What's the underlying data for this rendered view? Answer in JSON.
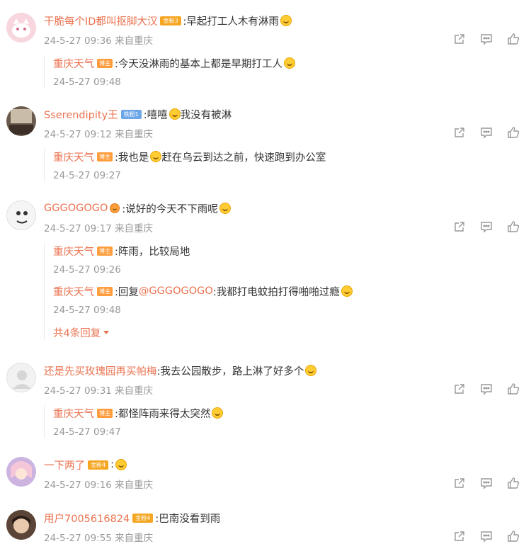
{
  "comments": [
    {
      "user": "干脆每个ID都叫抠脚大汉",
      "badge": "金粉3",
      "text": ":早起打工人木有淋雨",
      "meta": "24-5-27 09:36 来自重庆",
      "avatar_icon": "pink-cat-avatar",
      "replies": [
        {
          "user": "重庆天气",
          "badge": "博主",
          "text": ":今天没淋雨的基本上都是早期打工人",
          "time": "24-5-27 09:48"
        }
      ]
    },
    {
      "user": "Sserendipity王",
      "badge": "铁粉1",
      "text_before": ":嘻嘻",
      "text": "我没有被淋",
      "meta": "24-5-27 09:12 来自重庆",
      "avatar_icon": "room-photo-avatar",
      "replies": [
        {
          "user": "重庆天气",
          "badge": "博主",
          "text": ":我也是",
          "text_after": " 赶在乌云到达之前，快速跑到办公室",
          "time": "24-5-27 09:27"
        }
      ]
    },
    {
      "user": "GGGOGOGO",
      "text": ":说好的今天不下雨呢",
      "meta": "24-5-27 09:17 来自重庆",
      "avatar_icon": "cartoon-avatar",
      "replies": [
        {
          "user": "重庆天气",
          "badge": "博主",
          "text": ":阵雨，比较局地",
          "time": "24-5-27 09:26"
        },
        {
          "user": "重庆天气",
          "badge": "博主",
          "text_pre": ":回复",
          "mention": "@GGGOGOGO",
          "text": ":我都打电蚊拍打得啪啪过瘾",
          "time": "24-5-27 09:48"
        }
      ],
      "more_replies": "共4条回复"
    },
    {
      "user": "还是先买玫瑰园再买帕梅",
      "text": ":我去公园散步，路上淋了好多个",
      "meta": "24-5-27 09:31 来自重庆",
      "avatar_icon": "default-avatar",
      "replies": [
        {
          "user": "重庆天气",
          "badge": "博主",
          "text": ":都怪阵雨来得太突然",
          "time": "24-5-27 09:47"
        }
      ]
    },
    {
      "user": "一下两了",
      "badge": "金粉4",
      "text": ":",
      "meta": "24-5-27 09:16 来自重庆",
      "avatar_icon": "anime-girl-avatar",
      "replies": []
    },
    {
      "user": "用户7005616824",
      "badge": "金粉4",
      "text": ":巴南没看到雨",
      "meta": "24-5-27 09:55 来自重庆",
      "avatar_icon": "photo-avatar",
      "replies": []
    }
  ],
  "colors": {
    "username": "#eb7350",
    "meta": "#999999",
    "badge_gold": "#f5a623",
    "badge_blue": "#6ea7e8"
  }
}
